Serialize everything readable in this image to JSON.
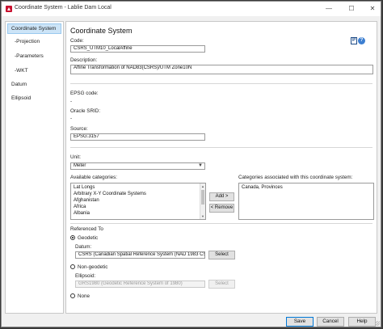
{
  "window": {
    "title": "Coordinate System - Lablie Dam Local"
  },
  "nav": {
    "items": [
      "Coordinate System",
      "-Projection",
      "-Parameters",
      "-WKT",
      "Datum",
      "Ellipsoid"
    ]
  },
  "page": {
    "title": "Coordinate System"
  },
  "form": {
    "code_label": "Code:",
    "code_value": "CSRS_UTM10_LocalAffine",
    "description_label": "Description:",
    "description_value": "Affine Transformation of NAD83(CSRS)/UTM Zone10N",
    "epsg_label": "EPSG code:",
    "epsg_value": "-",
    "oracle_label": "Oracle SRID:",
    "oracle_value": "-",
    "source_label": "Source:",
    "source_value": "EPSG:3157",
    "unit_label": "Unit:",
    "unit_value": "Meter",
    "available_label": "Available categories:",
    "available_items": [
      "Lat Longs",
      "Arbitrary X-Y Coordinate Systems",
      "Afghanistan",
      "Africa",
      "Albania"
    ],
    "associated_label": "Categories associated with this coordinate system:",
    "associated_items": [
      "Canada, Provinces"
    ],
    "add_label": "Add >",
    "remove_label": "< Remove",
    "referenced_label": "Referenced To",
    "geodetic_label": "Geodetic",
    "datum_label": "Datum:",
    "datum_value": "CSRS (Canadian Spatial Reference System (NAD 1983 CSRS))",
    "datum_select": "Select",
    "nongeodetic_label": "Non-geodetic",
    "ellipsoid_label": "Ellipsoid:",
    "ellipsoid_value": "GRS1980 (Geodetic Reference System of 1980)",
    "ellipsoid_select": "Select",
    "none_label": "None"
  },
  "footer": {
    "save": "Save",
    "cancel": "Cancel",
    "help": "Help"
  }
}
